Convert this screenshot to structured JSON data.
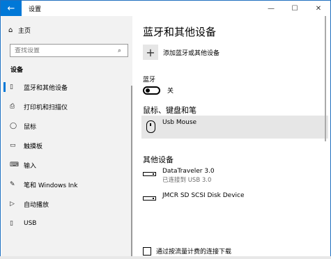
{
  "window": {
    "title": "设置",
    "back_icon": "←",
    "minimize_icon": "—",
    "maximize_icon": "☐",
    "close_icon": "✕"
  },
  "sidebar": {
    "home_label": "主页",
    "home_icon": "⌂",
    "search_placeholder": "查找设置",
    "search_icon": "⌕",
    "section_title": "设备",
    "items": [
      {
        "label": "蓝牙和其他设备",
        "icon": "▯",
        "active": true
      },
      {
        "label": "打印机和扫描仪",
        "icon": "⎙",
        "active": false
      },
      {
        "label": "鼠标",
        "icon": "◯",
        "active": false
      },
      {
        "label": "触摸板",
        "icon": "▭",
        "active": false
      },
      {
        "label": "输入",
        "icon": "⌨",
        "active": false
      },
      {
        "label": "笔和 Windows Ink",
        "icon": "✎",
        "active": false
      },
      {
        "label": "自动播放",
        "icon": "▷",
        "active": false
      },
      {
        "label": "USB",
        "icon": "▯",
        "active": false
      }
    ]
  },
  "main": {
    "title": "蓝牙和其他设备",
    "add_device_label": "添加蓝牙或其他设备",
    "add_icon": "+",
    "bluetooth_label": "蓝牙",
    "bluetooth_state": "关",
    "mouse_section_title": "鼠标、键盘和笔",
    "mouse_device": "Usb Mouse",
    "other_section_title": "其他设备",
    "other_devices": [
      {
        "name": "DataTraveler 3.0",
        "status": "已连接到 USB 3.0"
      },
      {
        "name": "JMCR SD SCSI Disk Device",
        "status": ""
      }
    ],
    "metered_label": "通过按流量计费的连接下载"
  }
}
